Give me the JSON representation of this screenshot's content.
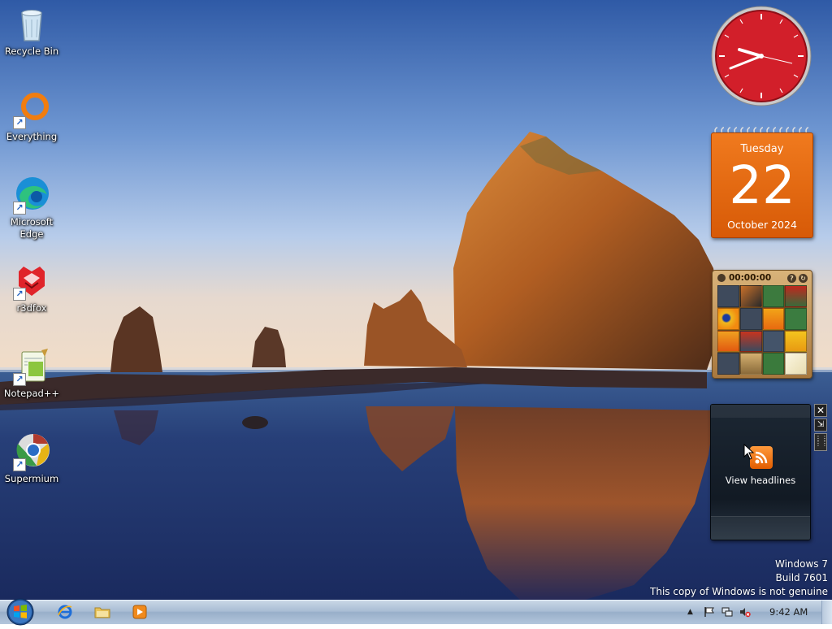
{
  "desktop": {
    "icons": [
      {
        "label": "Recycle Bin",
        "shortcut": false,
        "icon": "recycle-bin-icon"
      },
      {
        "label": "Everything",
        "shortcut": true,
        "icon": "everything-icon"
      },
      {
        "label": "Microsoft Edge",
        "shortcut": true,
        "icon": "edge-icon"
      },
      {
        "label": "r3dfox",
        "shortcut": true,
        "icon": "r3dfox-icon"
      },
      {
        "label": "Notepad++",
        "shortcut": true,
        "icon": "notepadpp-icon"
      },
      {
        "label": "Supermium",
        "shortcut": true,
        "icon": "supermium-icon"
      }
    ]
  },
  "gadgets": {
    "clock": {
      "time": "9:42"
    },
    "calendar": {
      "day": "Tuesday",
      "date": "22",
      "month_year": "October 2024"
    },
    "puzzle": {
      "timer": "00:00:00"
    },
    "feed": {
      "label": "View headlines"
    }
  },
  "watermark": {
    "line1": "Windows 7",
    "line2": "Build 7601",
    "line3": "This copy of Windows is not genuine"
  },
  "taskbar": {
    "pinned": [
      "internet-explorer-icon",
      "windows-explorer-icon",
      "media-player-icon"
    ],
    "tray": {
      "time": "9:42 AM"
    }
  },
  "colors": {
    "taskbar": "#a9bdd4",
    "calendar": "#e8680f",
    "clock": "#d2202b"
  }
}
